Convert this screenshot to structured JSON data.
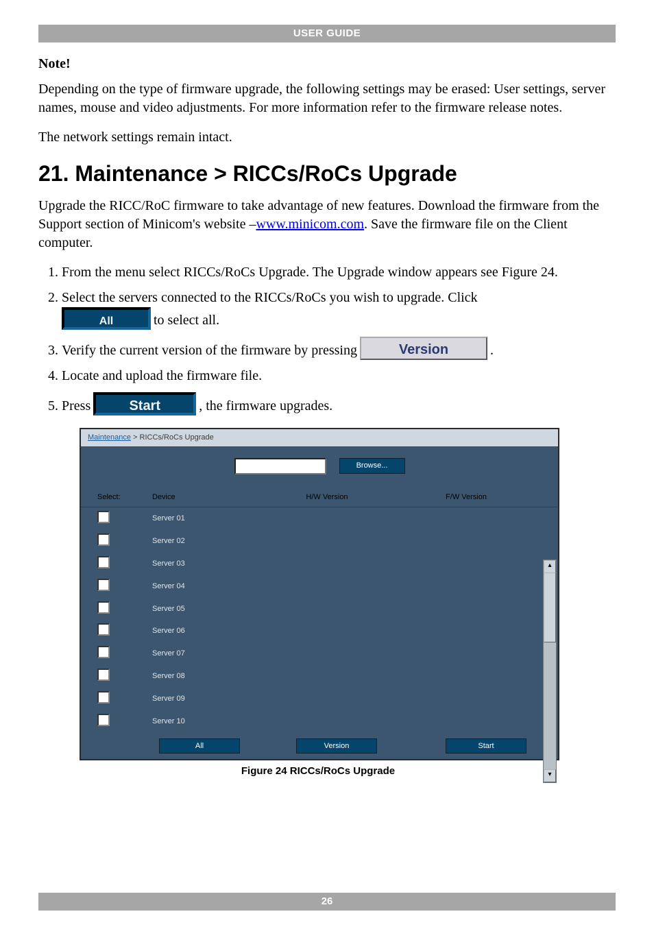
{
  "header": {
    "title": "USER GUIDE"
  },
  "note": {
    "heading": "Note!",
    "p1": "Depending on the type of firmware upgrade, the following settings may be erased: User settings, server names, mouse and video adjustments. For more information refer to the firmware release notes.",
    "p2": "The network settings remain intact."
  },
  "section": {
    "title": "21. Maintenance > RICCs/RoCs Upgrade"
  },
  "intro": {
    "pre": "Upgrade the RICC/RoC firmware to take advantage of new features. Download the firmware from the Support section of Minicom's website –",
    "link": "www.minicom.com",
    "post": ". Save the firmware file on the Client computer."
  },
  "steps": {
    "s1": "From the menu select RICCs/RoCs Upgrade. The Upgrade window appears see Figure 24.",
    "s2a": "Select the servers connected to the RICCs/RoCs you wish to upgrade. Click",
    "s2_btn": "All",
    "s2b": " to select all.",
    "s3a": "Verify the current version of the firmware by pressing ",
    "s3_btn": "Version",
    "s3b": ".",
    "s4": "Locate and upload the firmware file.",
    "s5a": "Press ",
    "s5_btn": "Start",
    "s5b": ", the firmware upgrades."
  },
  "figure": {
    "bc_root": "Maintenance",
    "bc_sep": " > ",
    "bc_leaf": "RICCs/RoCs Upgrade",
    "browse_btn": "Browse...",
    "col_select": "Select:",
    "col_device": "Device",
    "col_hw": "H/W Version",
    "col_fw": "F/W Version",
    "rows": [
      {
        "device": "Server 01"
      },
      {
        "device": "Server 02"
      },
      {
        "device": "Server 03"
      },
      {
        "device": "Server 04"
      },
      {
        "device": "Server 05"
      },
      {
        "device": "Server 06"
      },
      {
        "device": "Server 07"
      },
      {
        "device": "Server 08"
      },
      {
        "device": "Server 09"
      },
      {
        "device": "Server 10"
      }
    ],
    "btn_all": "All",
    "btn_version": "Version",
    "btn_start": "Start",
    "caption": "Figure 24 RICCs/RoCs Upgrade"
  },
  "footer": {
    "page": "26"
  }
}
